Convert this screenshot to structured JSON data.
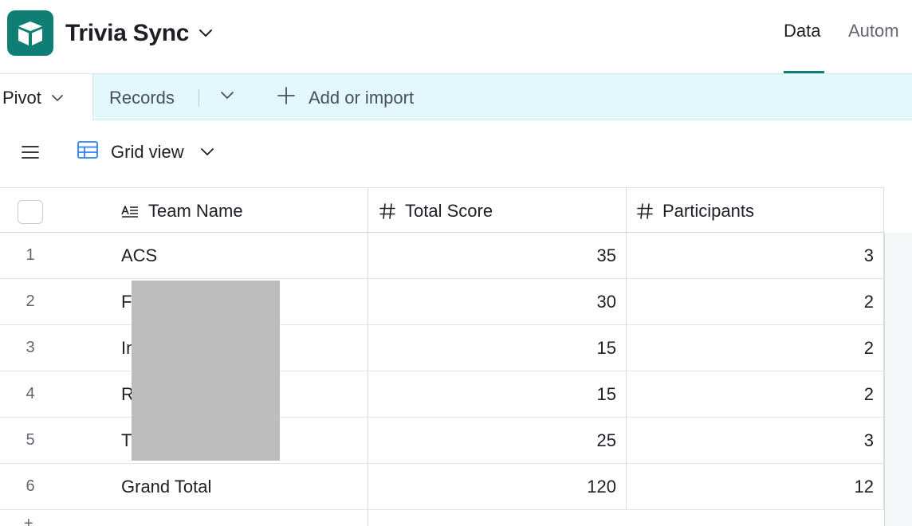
{
  "header": {
    "app_title": "Trivia Sync",
    "nav": [
      {
        "label": "Data",
        "active": true
      },
      {
        "label": "Autom",
        "active": false
      }
    ],
    "accent_color": "#0f7e75"
  },
  "tabs": {
    "pivot_label": "Pivot",
    "records_label": "Records",
    "add_label": "Add or import"
  },
  "viewbar": {
    "view_name": "Grid view"
  },
  "grid": {
    "columns": [
      {
        "label": "Team Name",
        "icon": "long-text-icon"
      },
      {
        "label": "Total Score",
        "icon": "number-icon"
      },
      {
        "label": "Participants",
        "icon": "number-icon"
      }
    ],
    "rows": [
      {
        "num": "1",
        "name": "ACS",
        "score": "35",
        "participants": "3"
      },
      {
        "num": "2",
        "name": "F",
        "score": "30",
        "participants": "2"
      },
      {
        "num": "3",
        "name": "In",
        "score": "15",
        "participants": "2"
      },
      {
        "num": "4",
        "name": "R",
        "score": "15",
        "participants": "2"
      },
      {
        "num": "5",
        "name": "T",
        "score": "25",
        "participants": "3"
      },
      {
        "num": "6",
        "name": "Grand Total",
        "score": "120",
        "participants": "12"
      }
    ]
  }
}
